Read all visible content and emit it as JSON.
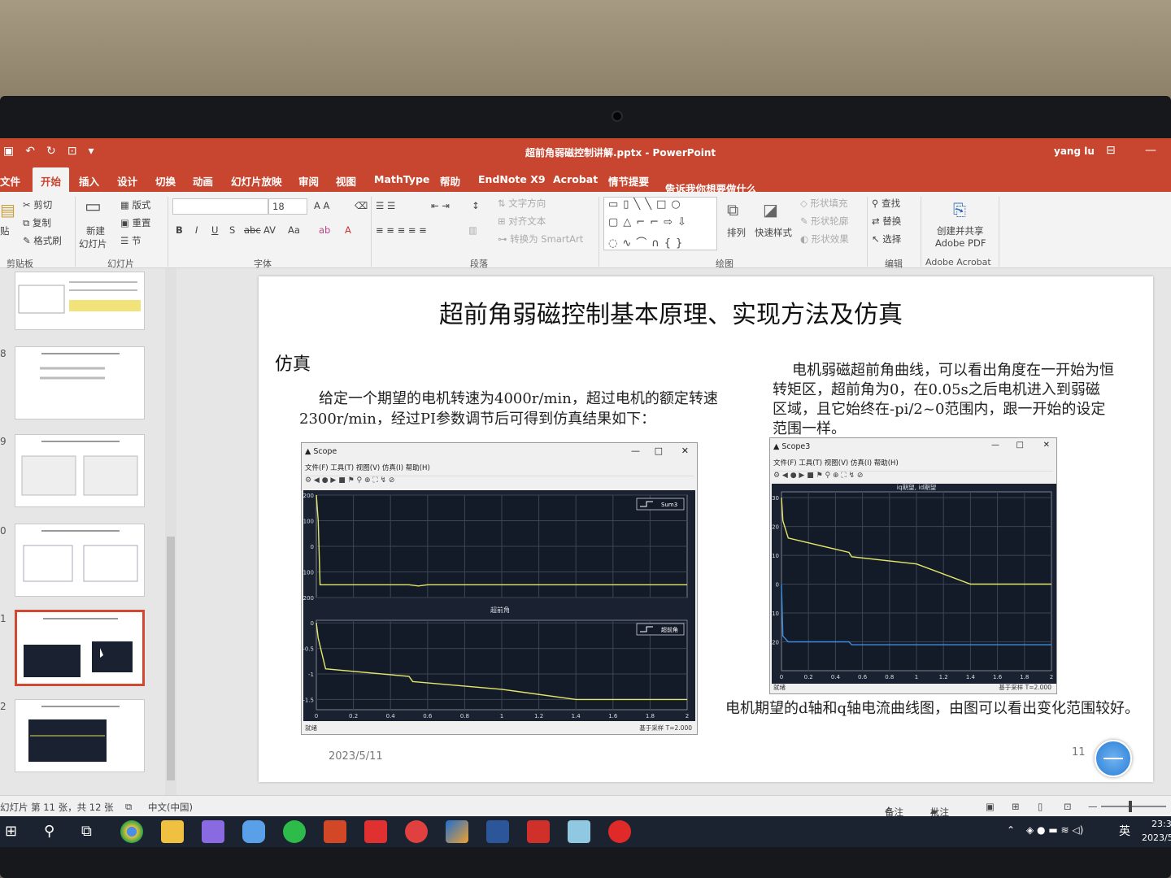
{
  "window": {
    "title": "超前角弱磁控制讲解.pptx - PowerPoint",
    "user": "yang lu"
  },
  "menu": [
    "文件",
    "开始",
    "插入",
    "设计",
    "切换",
    "动画",
    "幻灯片放映",
    "审阅",
    "视图",
    "MathType",
    "帮助",
    "EndNote X9",
    "Acrobat",
    "情节提要",
    "告诉我你想要做什么"
  ],
  "ribbon": {
    "clipboard": {
      "cut": "剪切",
      "copy": "复制",
      "format_painter": "格式刷",
      "paste": "贴",
      "group": "剪贴板"
    },
    "slides": {
      "new_slide_1": "新建",
      "new_slide_2": "幻灯片",
      "layout": "版式",
      "reset": "重置",
      "section": "节",
      "group": "幻灯片"
    },
    "font": {
      "size": "18",
      "group": "字体"
    },
    "paragraph": {
      "text_direction": "文字方向",
      "align_text": "对齐文本",
      "smartart": "转换为 SmartArt",
      "group": "段落"
    },
    "drawing": {
      "arrange": "排列",
      "quick_styles": "快速样式",
      "fill": "形状填充",
      "outline": "形状轮廓",
      "effects": "形状效果",
      "group": "绘图"
    },
    "editing": {
      "find": "查找",
      "replace": "替换",
      "select": "选择",
      "group": "编辑"
    },
    "acrobat": {
      "create_1": "创建并共享",
      "create_2": "Adobe PDF",
      "group": "Adobe Acrobat"
    }
  },
  "thumbnails": [
    "8",
    "9",
    "0",
    "1",
    "2"
  ],
  "slide": {
    "title": "超前角弱磁控制基本原理、实现方法及仿真",
    "heading": "仿真",
    "para1": "给定一个期望的电机转速为4000r/min，超过电机的额定转速2300r/min，经过PI参数调节后可得到仿真结果如下：",
    "para2": "电机弱磁超前角曲线，可以看出角度在一开始为恒转矩区，超前角为0，在0.05s之后电机进入到弱磁区域，且它始终在-pi/2~0范围内，跟一开始的设定范围一样。",
    "para3": "电机期望的d轴和q轴电流曲线图，由图可以看出变化范围较好。",
    "date": "2023/5/11",
    "page": "11"
  },
  "scope1": {
    "title": "Scope",
    "menu": "文件(F)  工具(T)  视图(V)  仿真(I)  帮助(H)",
    "legend_top": "Sum3",
    "subplot2_title": "超前角",
    "legend_bottom": "超前角",
    "status_left": "就绪",
    "status_right": "基于采样  T=2.000"
  },
  "scope2": {
    "title": "Scope3",
    "menu": "文件(F)  工具(T)  视图(V)  仿真(I)  帮助(H)",
    "plot_title": "iq期望, id期望",
    "status_left": "就绪",
    "status_right": "基于采样  T=2.000"
  },
  "chart_data": [
    {
      "type": "line",
      "title": "",
      "x": [
        0,
        0.01,
        0.02,
        0.05,
        0.5,
        0.55,
        0.6,
        1.0,
        1.5,
        2.0
      ],
      "series": [
        {
          "name": "Sum3",
          "values": [
            200,
            100,
            -150,
            -150,
            -150,
            -155,
            -150,
            -150,
            -150,
            -150
          ]
        }
      ],
      "xlim": [
        0,
        2
      ],
      "ylim": [
        -200,
        200
      ],
      "yticks": [
        "200",
        "100",
        "0",
        "-100",
        "-200"
      ],
      "grid": true,
      "legend": "top-right"
    },
    {
      "type": "line",
      "title": "超前角",
      "x": [
        0,
        0.01,
        0.05,
        0.5,
        0.52,
        1.0,
        1.4,
        2.0
      ],
      "series": [
        {
          "name": "超前角",
          "values": [
            0,
            -0.3,
            -0.9,
            -1.05,
            -1.15,
            -1.3,
            -1.5,
            -1.5
          ]
        }
      ],
      "xlim": [
        0,
        2
      ],
      "ylim": [
        -1.7,
        0.05
      ],
      "xticks": [
        "0",
        "0.2",
        "0.4",
        "0.6",
        "0.8",
        "1",
        "1.2",
        "1.4",
        "1.6",
        "1.8",
        "2"
      ],
      "yticks": [
        "0",
        "-0.5",
        "-1",
        "-1.5"
      ],
      "grid": true,
      "legend": "top-right"
    },
    {
      "type": "line",
      "title": "iq期望, id期望",
      "x": [
        0,
        0.01,
        0.05,
        0.5,
        0.52,
        1.0,
        1.4,
        2.0
      ],
      "series": [
        {
          "name": "iq期望",
          "values": [
            30,
            22,
            16,
            11,
            9.5,
            7,
            0,
            0
          ]
        },
        {
          "name": "id期望",
          "values": [
            0,
            -18,
            -20,
            -20,
            -21,
            -21,
            -21,
            -21
          ]
        }
      ],
      "xlim": [
        0,
        2
      ],
      "ylim": [
        -30,
        32
      ],
      "xticks": [
        "0",
        "0.2",
        "0.4",
        "0.6",
        "0.8",
        "1",
        "1.2",
        "1.4",
        "1.6",
        "1.8",
        "2"
      ],
      "yticks": [
        "30",
        "20",
        "10",
        "0",
        "-10",
        "-20"
      ],
      "grid": true
    }
  ],
  "status": {
    "slide_info": "幻灯片 第 11 张，共 12 张",
    "language": "中文(中国)",
    "notes": "备注",
    "comments": "批注"
  },
  "tray": {
    "ime": "英",
    "time": "23:3",
    "date": "2023/5"
  }
}
